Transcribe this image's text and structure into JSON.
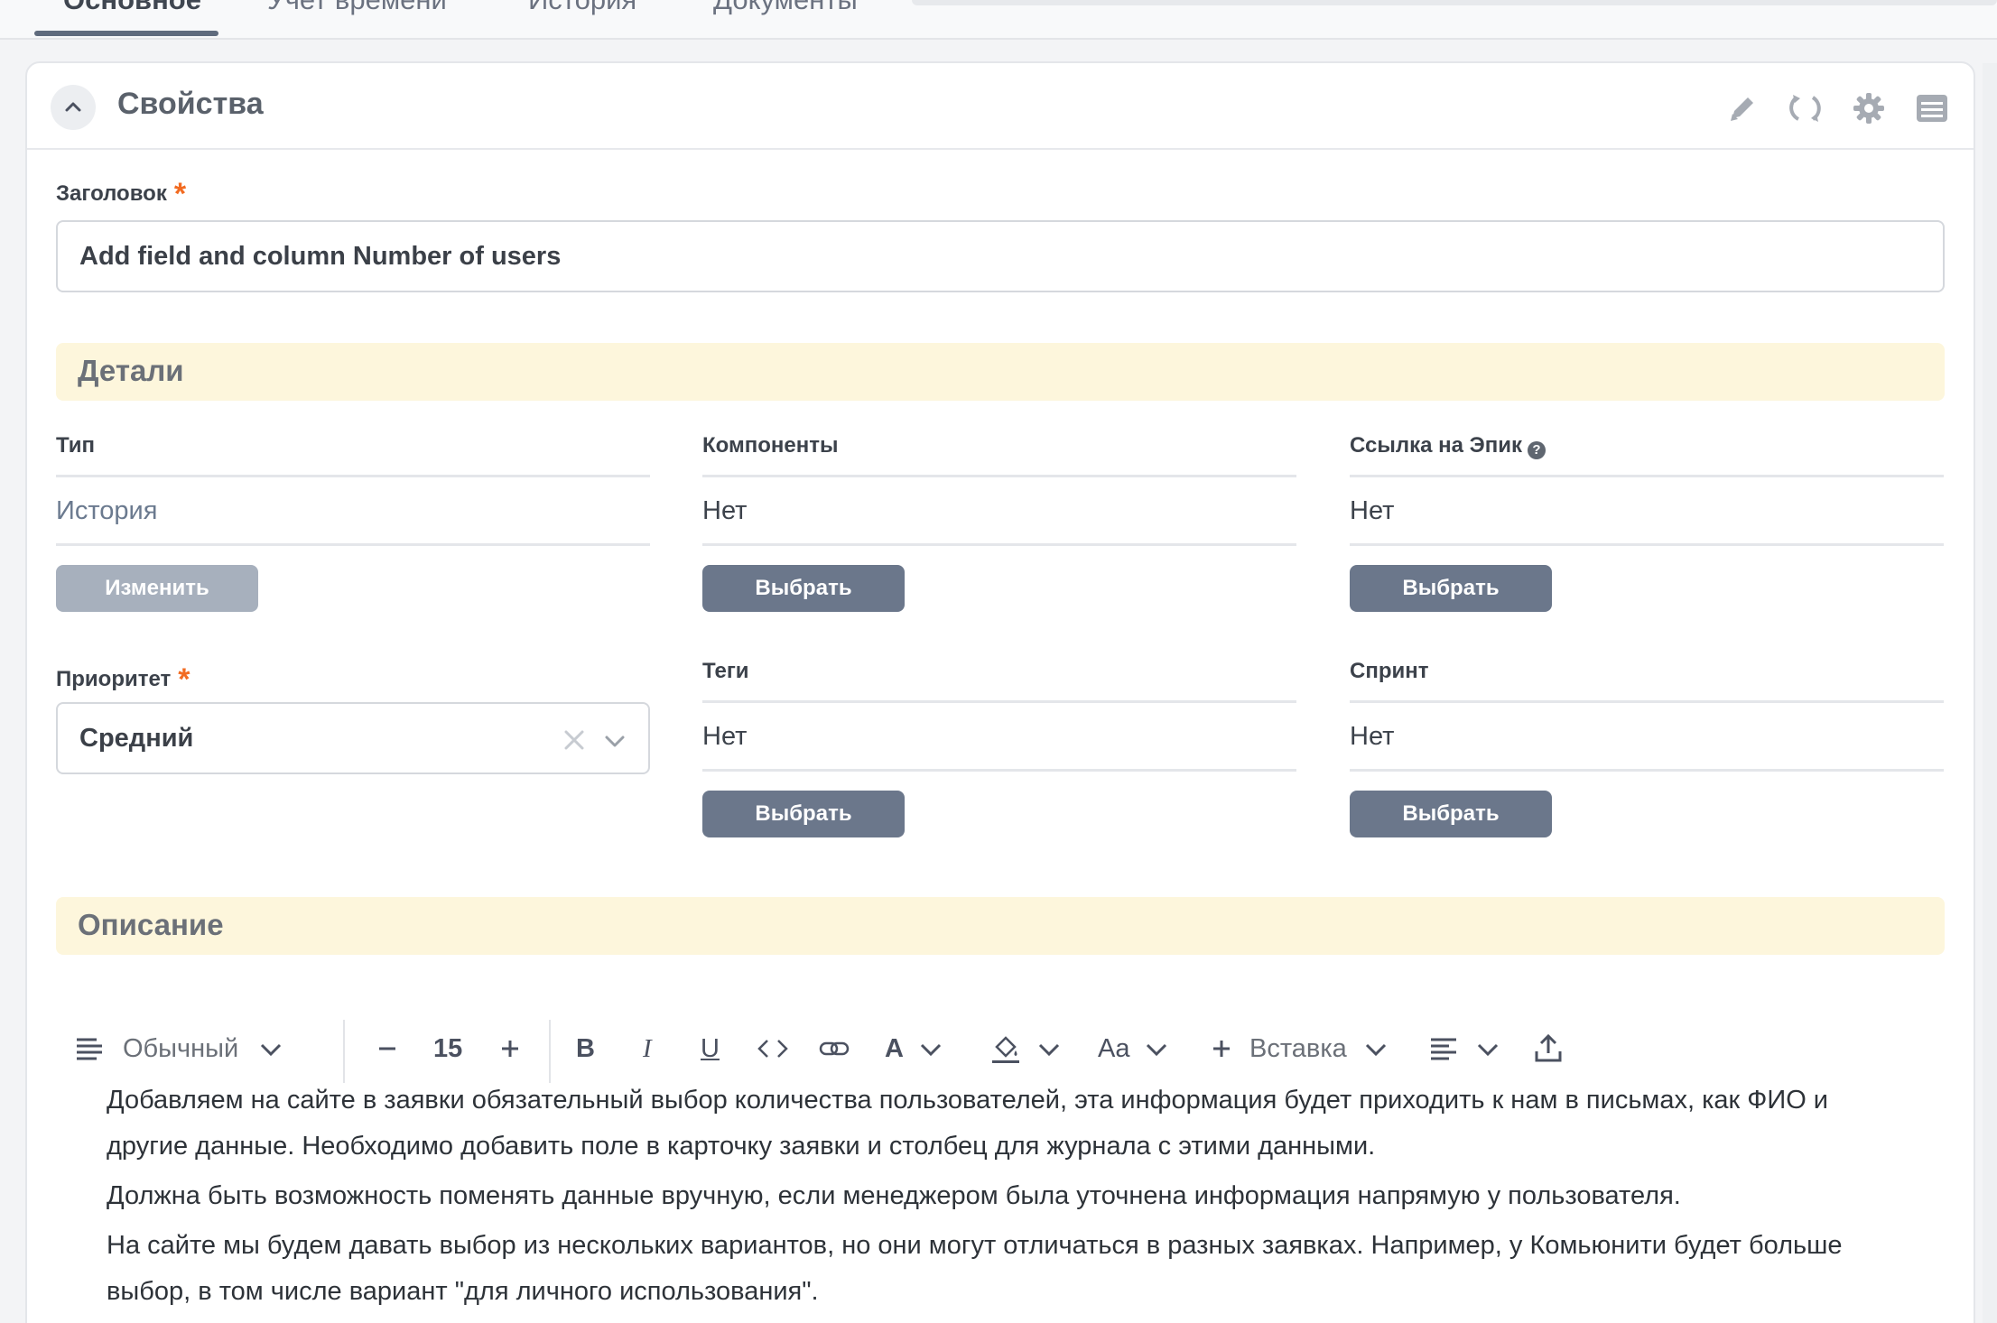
{
  "tabs": [
    {
      "label": "Основное",
      "active": true
    },
    {
      "label": "Учет времени",
      "active": false
    },
    {
      "label": "История",
      "active": false
    },
    {
      "label": "Документы",
      "active": false
    }
  ],
  "card": {
    "title": "Свойства",
    "icons": [
      "edit-icon",
      "refresh-icon",
      "gear-icon",
      "list-icon"
    ]
  },
  "title_field": {
    "label": "Заголовок",
    "value": "Add field and column Number of users"
  },
  "details": {
    "section_title": "Детали",
    "type": {
      "label": "Тип",
      "value": "История",
      "button": "Изменить"
    },
    "components": {
      "label": "Компоненты",
      "value": "Нет",
      "button": "Выбрать"
    },
    "epic_link": {
      "label": "Ссылка на Эпик",
      "value": "Нет",
      "button": "Выбрать"
    },
    "priority": {
      "label": "Приоритет",
      "value": "Средний"
    },
    "tags": {
      "label": "Теги",
      "value": "Нет",
      "button": "Выбрать"
    },
    "sprint": {
      "label": "Спринт",
      "value": "Нет",
      "button": "Выбрать"
    }
  },
  "description": {
    "section_title": "Описание",
    "toolbar": {
      "block_type": "Обычный",
      "font_size": "15",
      "case_label": "Aa",
      "insert_label": "Вставка"
    },
    "paragraphs": [
      "Добавляем на сайте в заявки обязательный выбор количества пользователей, эта информация будет приходить к нам в письмах, как ФИО и другие данные. Необходимо добавить поле в карточку заявки и столбец для журнала с этими данными.",
      "Должна быть возможность поменять данные вручную, если менеджером была уточнена информация напрямую у пользователя.",
      "На сайте мы будем давать выбор из нескольких вариантов, но они могут отличаться в разных заявках. Например, у Комьюнити будет больше выбор, в том числе вариант \"для личного использования\"."
    ]
  },
  "colors": {
    "accent_button": "#6b778b",
    "disabled_button": "#a7b0bd",
    "section_band": "#fdf6dc",
    "required_mark": "#f26b21"
  }
}
